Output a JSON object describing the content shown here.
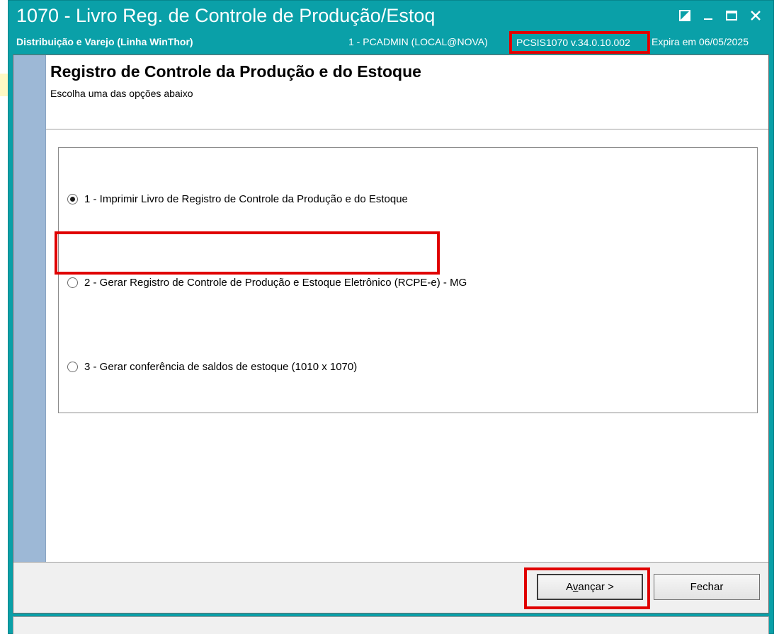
{
  "window": {
    "title": "1070 - Livro Reg. de Controle de Produção/Estoq",
    "subtitle": "Distribuição e Varejo (Linha WinThor)",
    "user_info": "1 - PCADMIN (LOCAL@NOVA)",
    "version": "PCSIS1070  v.34.0.10.002",
    "expiry": "Expira em 06/05/2025"
  },
  "header": {
    "title": "Registro de Controle da Produção e do Estoque",
    "subtitle": "Escolha uma das opções abaixo"
  },
  "options": [
    {
      "label": "1 - Imprimir Livro de Registro de Controle da Produção e do Estoque",
      "checked": true
    },
    {
      "label": "2 - Gerar Registro de Controle de Produção e Estoque Eletrônico (RCPE-e) - MG",
      "checked": false
    },
    {
      "label": "3 - Gerar conferência de saldos de estoque (1010 x 1070)",
      "checked": false
    }
  ],
  "buttons": {
    "next": "Avançar >",
    "next_accel_index": 1,
    "close": "Fechar"
  },
  "colors": {
    "titlebar": "#0aa0a8",
    "sidebar": "#9db8d6",
    "highlight": "#e00000"
  }
}
